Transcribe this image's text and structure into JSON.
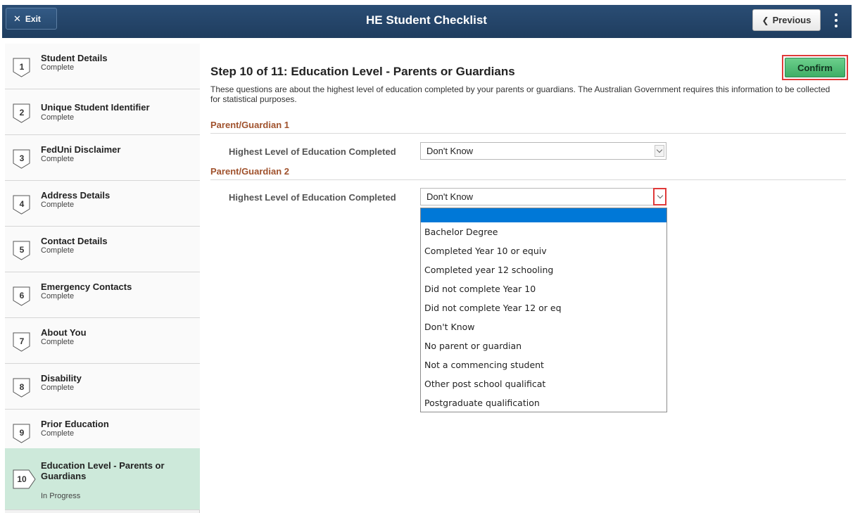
{
  "header": {
    "exit_label": "Exit",
    "title": "HE Student Checklist",
    "previous_label": "Previous"
  },
  "sidebar": {
    "items": [
      {
        "num": "1",
        "title": "Student Details",
        "status": "Complete"
      },
      {
        "num": "2",
        "title": "Unique Student Identifier",
        "status": "Complete"
      },
      {
        "num": "3",
        "title": "FedUni Disclaimer",
        "status": "Complete"
      },
      {
        "num": "4",
        "title": "Address Details",
        "status": "Complete"
      },
      {
        "num": "5",
        "title": "Contact Details",
        "status": "Complete"
      },
      {
        "num": "6",
        "title": "Emergency Contacts",
        "status": "Complete"
      },
      {
        "num": "7",
        "title": "About You",
        "status": "Complete"
      },
      {
        "num": "8",
        "title": "Disability",
        "status": "Complete"
      },
      {
        "num": "9",
        "title": "Prior Education",
        "status": "Complete"
      },
      {
        "num": "10",
        "title": "Education Level - Parents or Guardians",
        "status": "In Progress"
      }
    ],
    "active_index": 9
  },
  "main": {
    "confirm_label": "Confirm",
    "step_title": "Step 10 of 11: Education Level - Parents or Guardians",
    "intro": "These questions are about the highest level of education completed by your parents or guardians.  The Australian Government requires this information to be collected for statistical purposes.",
    "sections": [
      {
        "heading": "Parent/Guardian 1",
        "field_label": "Highest Level of Education Completed",
        "value": "Don't Know"
      },
      {
        "heading": "Parent/Guardian 2",
        "field_label": "Highest Level of Education Completed",
        "value": "Don't Know"
      }
    ],
    "dropdown_options": [
      "",
      "Bachelor Degree",
      "Completed Year 10 or equiv",
      "Completed year 12 schooling",
      "Did not complete Year 10",
      "Did not complete Year 12 or eq",
      "Don't Know",
      "No parent or guardian",
      "Not a commencing student",
      "Other post school qualificat",
      "Postgraduate qualification"
    ]
  },
  "colors": {
    "header_bg": "#234569",
    "active_step_bg": "#cde9da",
    "section_heading": "#a0522d",
    "confirm_green": "#3fae66",
    "highlight_red": "#e03a3a",
    "selected_option": "#0078d7"
  }
}
